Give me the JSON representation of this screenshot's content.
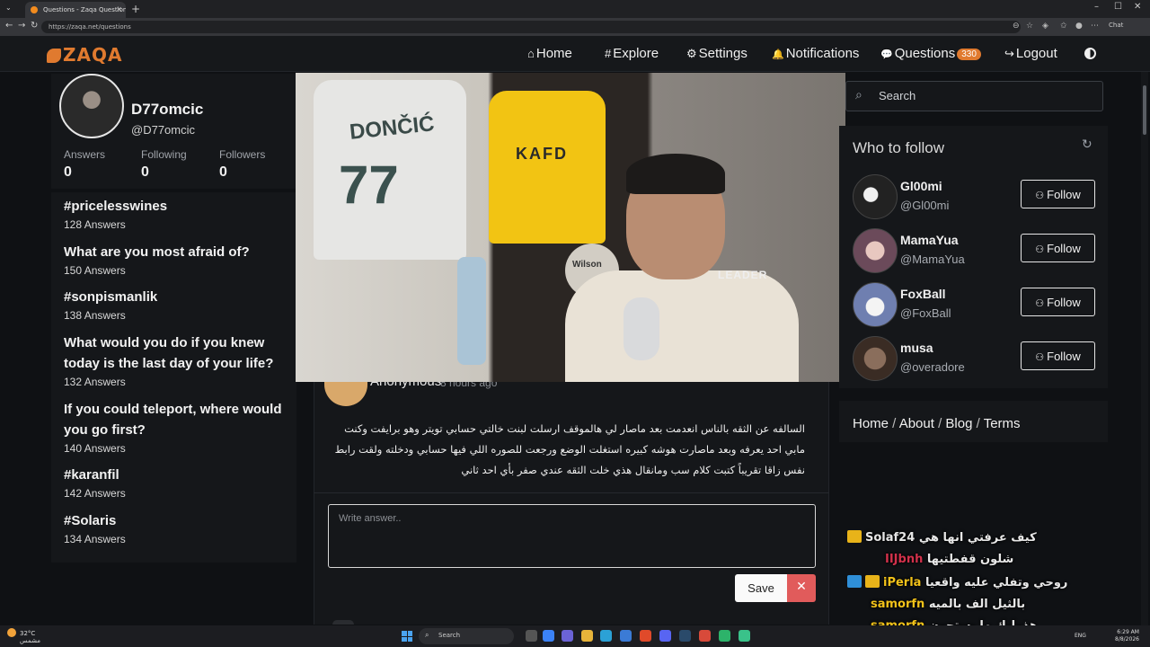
{
  "browser": {
    "tab_title": "Questions - Zaqa Question & An...",
    "url": "https://zaqa.net/questions",
    "chat_label": "Chat",
    "new_tab": "+"
  },
  "nav": {
    "logo": "ZAQA",
    "items": [
      {
        "icon": "⌂",
        "label": "Home"
      },
      {
        "icon": "#",
        "label": "Explore"
      },
      {
        "icon": "⚙",
        "label": "Settings"
      },
      {
        "icon": "🔔",
        "label": "Notifications"
      },
      {
        "icon": "💬",
        "label": "Questions",
        "badge": "330"
      },
      {
        "icon": "↪",
        "label": "Logout"
      }
    ]
  },
  "profile": {
    "name": "D77omcic",
    "handle": "@D77omcic",
    "stats": [
      {
        "label": "Answers",
        "value": "0"
      },
      {
        "label": "Following",
        "value": "0"
      },
      {
        "label": "Followers",
        "value": "0"
      }
    ]
  },
  "trending": [
    {
      "title": "#pricelesswines",
      "count": "128 Answers"
    },
    {
      "title": "What are you most afraid of?",
      "count": "150 Answers"
    },
    {
      "title": "#sonpismanlik",
      "count": "138 Answers"
    },
    {
      "title": "What would you do if you knew today is the last day of your life?",
      "count": "132 Answers"
    },
    {
      "title": "If you could teleport, where would you go first?",
      "count": "140 Answers"
    },
    {
      "title": "#karanfil",
      "count": "142 Answers"
    },
    {
      "title": "#Solaris",
      "count": "134 Answers"
    }
  ],
  "video": {
    "jersey1_name": "DONČIĆ",
    "jersey1_number": "77",
    "jersey2_text": "KAFD",
    "ball_text": "Wilson",
    "chair_text": "LEADER"
  },
  "post": {
    "author": "Anonymous",
    "time": "8 hours ago",
    "question": "السالفه عن الثقه بالناس انعدمت بعد ماصار لي هالموقف ارسلت لبنت خالتي حسابي تويتر وهو برايفت وكنت مابي احد يعرفه وبعد ماصارت هوشه كبيره استغلت الوضع ورجعت للصوره اللي فيها حسابي ودخلته ولقت رابط نفس زاقا تقريباً كتبت كلام سب ومانقال هذي خلت الثقه عندي صفر بأي احد ثاني",
    "answer_placeholder": "Write answer..",
    "save_label": "Save",
    "cancel_label": "✕"
  },
  "sidebar": {
    "search_placeholder": "Search",
    "who_to_follow_title": "Who to follow",
    "follow_label": "Follow",
    "users": [
      {
        "name": "Gl00mi",
        "handle": "@Gl00mi"
      },
      {
        "name": "MamaYua",
        "handle": "@MamaYua"
      },
      {
        "name": "FoxBall",
        "handle": "@FoxBall"
      },
      {
        "name": "musa",
        "handle": "@overadore"
      }
    ],
    "footer_links": [
      "Home",
      "About",
      "Blog",
      "Terms"
    ]
  },
  "stream_chat": [
    {
      "user": "Solaf24",
      "user_color": "#e6e6e6",
      "message": "كيف عرفتي انها هي",
      "badges": [
        "crown"
      ]
    },
    {
      "user": "IIJbnh",
      "user_color": "#d2314b",
      "message": "شلون قفطتيها",
      "badges": []
    },
    {
      "user": "iPerla",
      "user_color": "#f2c21a",
      "message": "روحي وتفلي عليه واقعيا",
      "badges": [
        "arrow",
        "crown"
      ]
    },
    {
      "user": "samorfn",
      "user_color": "#f2c21a",
      "message": "بالثيل الف بالميه",
      "badges": []
    },
    {
      "user": "samorfn",
      "user_color": "#f2c21a",
      "message": "هذوليك ما يستحون",
      "badges": []
    }
  ],
  "taskbar": {
    "weather_temp": "32°C",
    "weather_desc": "مشمس",
    "search_label": "Search",
    "lang": "ENG",
    "time": "6:29 AM",
    "date": "8/8/2026"
  }
}
